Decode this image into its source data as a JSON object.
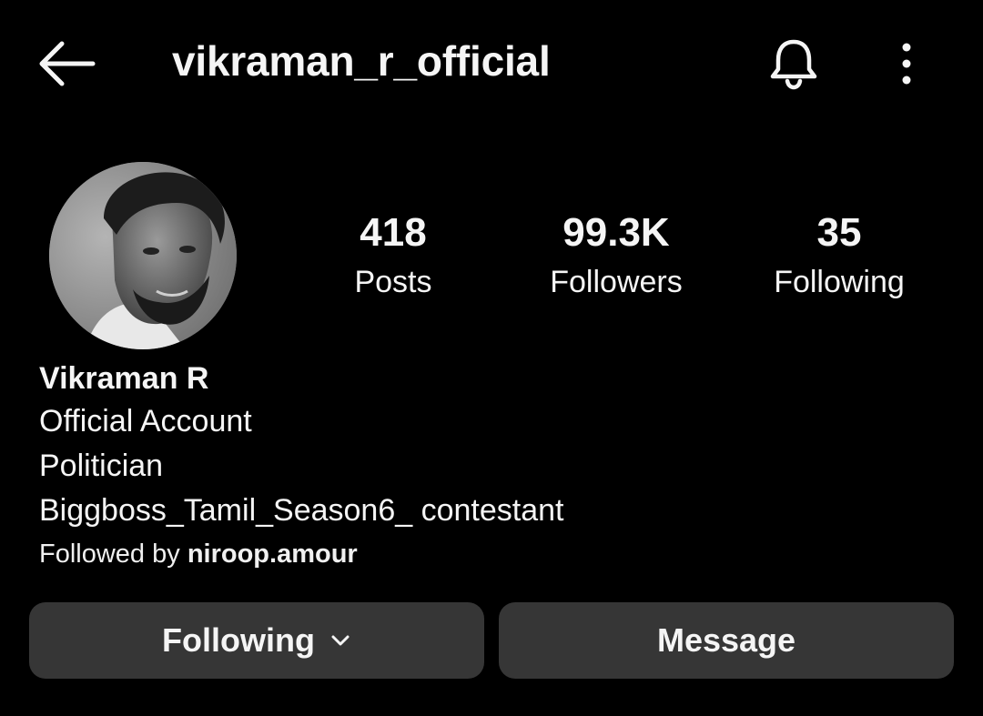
{
  "header": {
    "username": "vikraman_r_official",
    "back_icon": "arrow-left-icon",
    "bell_icon": "bell-icon",
    "more_icon": "more-vertical-icon"
  },
  "profile": {
    "avatar_icon": "profile-photo"
  },
  "stats": {
    "posts": {
      "value": "418",
      "label": "Posts"
    },
    "followers": {
      "value": "99.3K",
      "label": "Followers"
    },
    "following": {
      "value": "35",
      "label": "Following"
    }
  },
  "bio": {
    "name": "Vikraman R",
    "lines": [
      "Official Account",
      "Politician",
      "Biggboss_Tamil_Season6_ contestant"
    ],
    "followed_by_prefix": "Followed by ",
    "followed_by_user": "niroop.amour"
  },
  "actions": {
    "following_label": "Following",
    "message_label": "Message"
  },
  "colors": {
    "background": "#000000",
    "text": "#f5f5f5",
    "button_bg": "#363636"
  }
}
